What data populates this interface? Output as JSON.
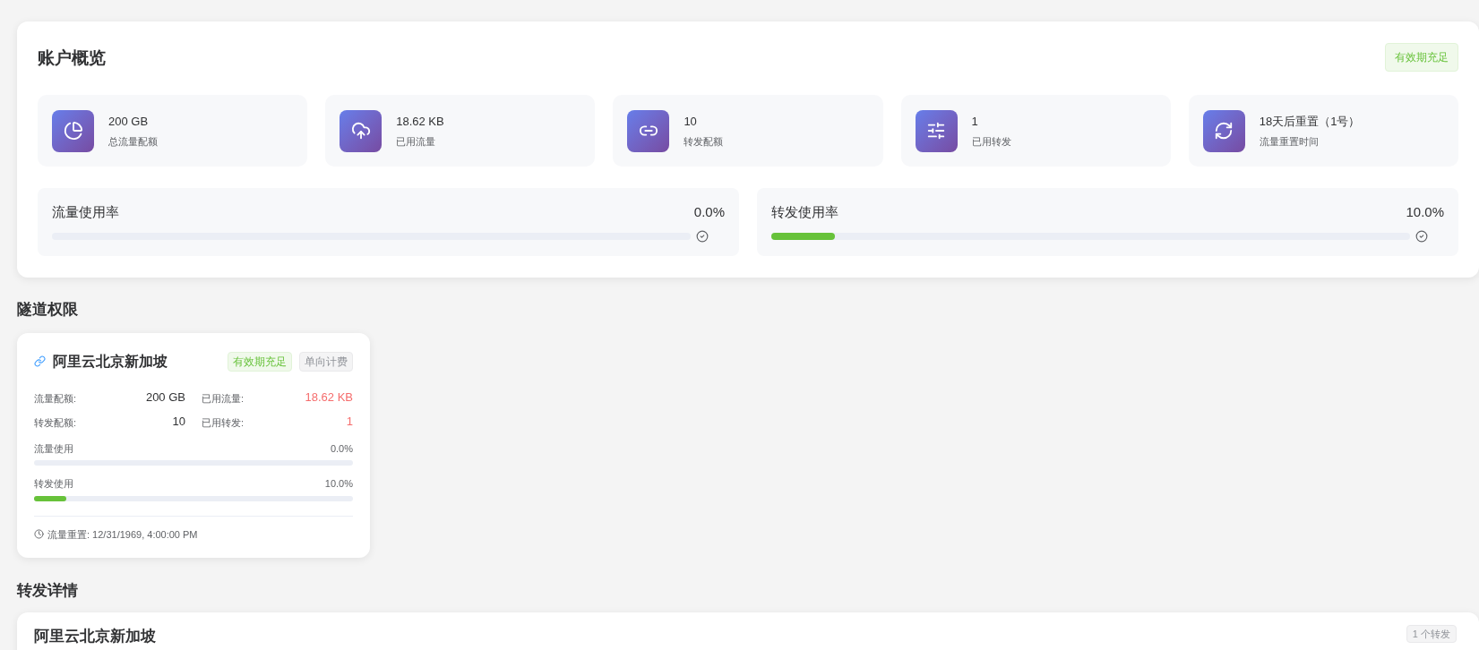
{
  "overview": {
    "title": "账户概览",
    "badge": {
      "label": "有效期充足",
      "kind": "success"
    },
    "stats": [
      {
        "value": "200 GB",
        "label": "总流量配额"
      },
      {
        "value": "18.62 KB",
        "label": "已用流量"
      },
      {
        "value": "10",
        "label": "转发配额"
      },
      {
        "value": "1",
        "label": "已用转发"
      },
      {
        "value": "18天后重置（1号）",
        "label": "流量重置时间"
      }
    ],
    "usage": [
      {
        "label": "流量使用率",
        "reading": "0.0%",
        "level": 0
      },
      {
        "label": "转发使用率",
        "reading": "10.0%",
        "level": 0.1
      }
    ]
  },
  "tunnels": {
    "title": "隧道权限",
    "cards": [
      {
        "name": "阿里云北京新加坡",
        "tags": [
          {
            "label": "有效期充足",
            "kind": "success"
          },
          {
            "label": "单向计费",
            "kind": "info"
          }
        ],
        "quotas": [
          {
            "label": "流量配额:",
            "value": "200 GB",
            "emphasis": false
          },
          {
            "label": "已用流量:",
            "value": "18.62 KB",
            "emphasis": true
          },
          {
            "label": "转发配额:",
            "value": "10",
            "emphasis": false
          },
          {
            "label": "已用转发:",
            "value": "1",
            "emphasis": true
          }
        ],
        "usage": [
          {
            "label": "流量使用",
            "reading": "0.0%",
            "level": 0
          },
          {
            "label": "转发使用",
            "reading": "10.0%",
            "level": 0.1
          }
        ],
        "reset": "流量重置: 12/31/1969, 4:00:00 PM"
      }
    ]
  },
  "forwards": {
    "title": "转发详情",
    "cards": [
      {
        "name": "阿里云北京新加坡",
        "count": "1 个转发"
      }
    ]
  }
}
